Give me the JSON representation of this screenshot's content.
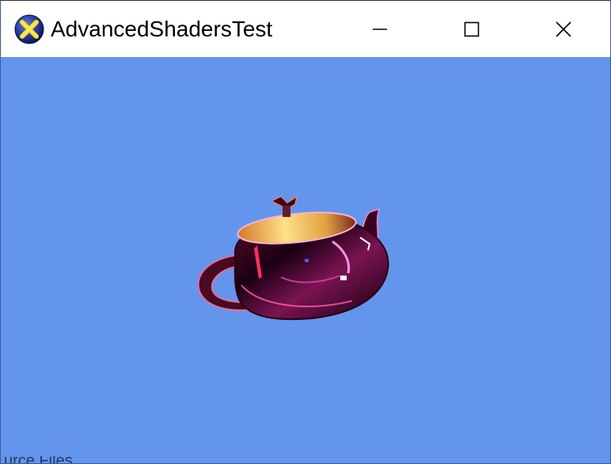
{
  "window": {
    "title": "AdvancedShadersTest",
    "icon": "directx-x-icon",
    "controls": {
      "minimize": "minimize-icon",
      "maximize": "maximize-icon",
      "close": "close-icon"
    }
  },
  "scene": {
    "background_color": "#6495ed",
    "object": "teapot-render"
  },
  "background_window": {
    "partial_text": "urce Files"
  }
}
